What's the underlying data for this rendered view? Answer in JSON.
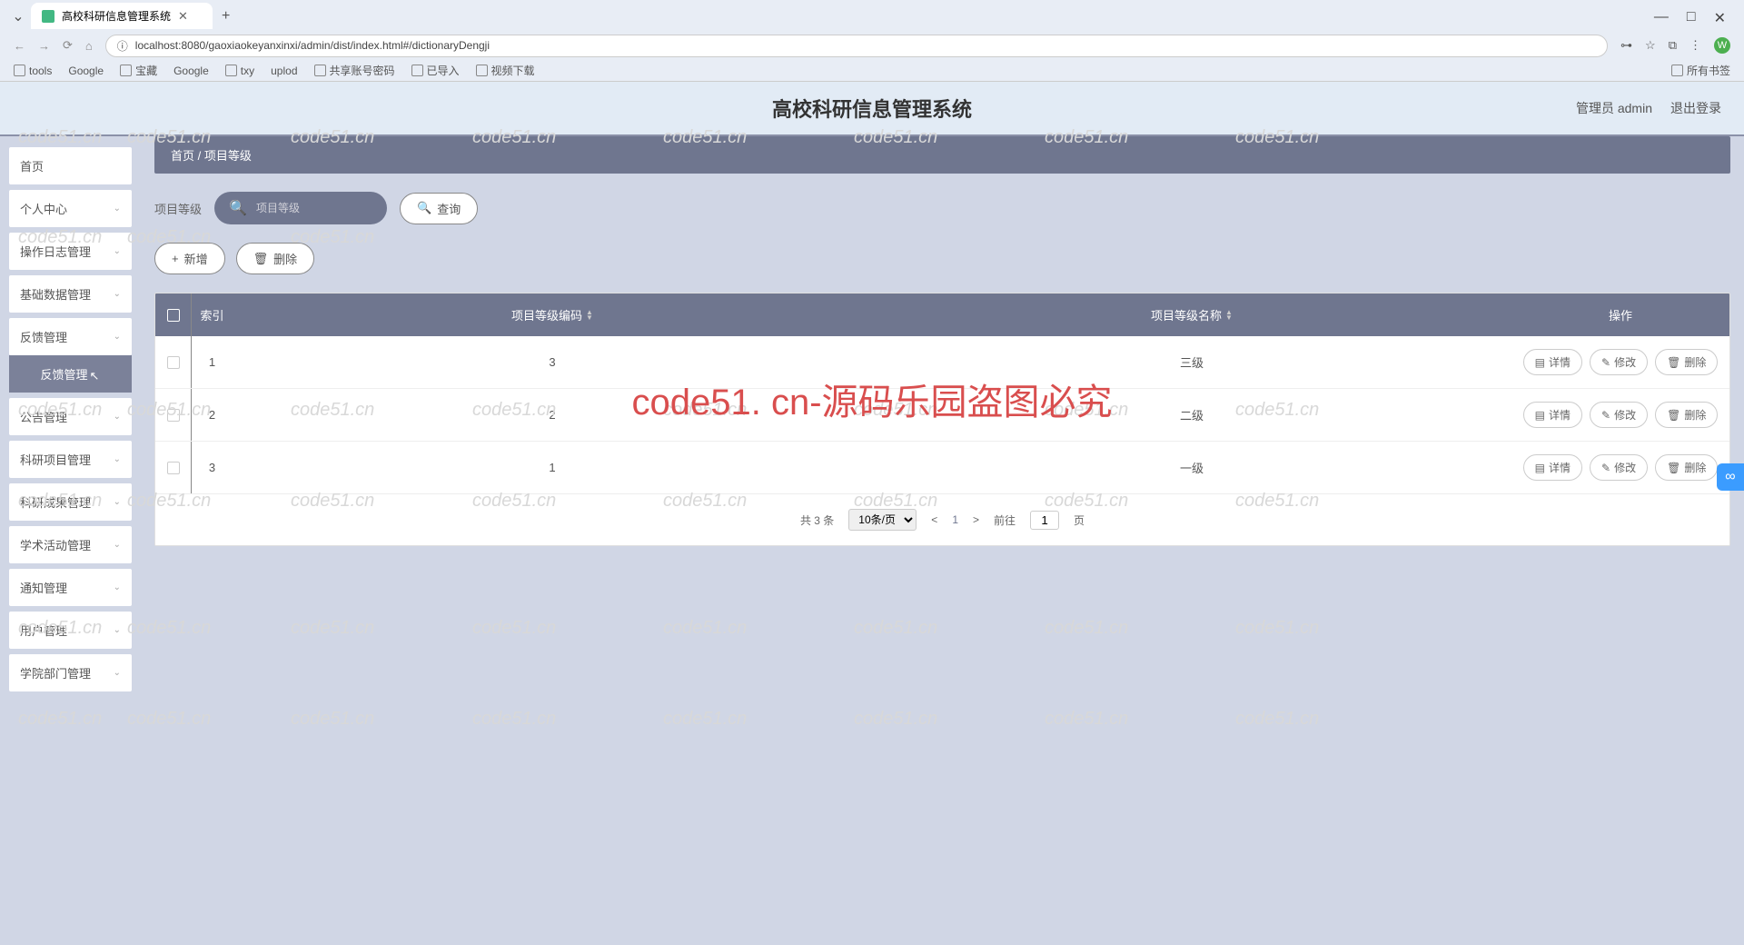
{
  "browser": {
    "tab_title": "高校科研信息管理系统",
    "url": "localhost:8080/gaoxiaokeyanxinxi/admin/dist/index.html#/dictionaryDengji",
    "bookmarks": [
      "tools",
      "Google",
      "宝藏",
      "Google",
      "txy",
      "uplod",
      "共享账号密码",
      "已导入",
      "视频下载"
    ],
    "bookmarks_right": "所有书签",
    "avatar_letter": "W"
  },
  "header": {
    "title": "高校科研信息管理系统",
    "user_label": "管理员 admin",
    "logout": "退出登录"
  },
  "sidebar": {
    "items": [
      {
        "label": "首页",
        "expandable": false
      },
      {
        "label": "个人中心",
        "expandable": true
      },
      {
        "label": "操作日志管理",
        "expandable": true
      },
      {
        "label": "基础数据管理",
        "expandable": true
      },
      {
        "label": "反馈管理",
        "expandable": true,
        "expanded": true,
        "sub": "反馈管理"
      },
      {
        "label": "公告管理",
        "expandable": true
      },
      {
        "label": "科研项目管理",
        "expandable": true
      },
      {
        "label": "科研成果管理",
        "expandable": true
      },
      {
        "label": "学术活动管理",
        "expandable": true
      },
      {
        "label": "通知管理",
        "expandable": true
      },
      {
        "label": "用户管理",
        "expandable": true
      },
      {
        "label": "学院部门管理",
        "expandable": true
      }
    ]
  },
  "breadcrumb": {
    "home": "首页",
    "sep": "/",
    "current": "项目等级"
  },
  "search": {
    "label": "项目等级",
    "placeholder": "项目等级",
    "query_btn": "查询"
  },
  "actions": {
    "add": "新增",
    "delete": "删除"
  },
  "table": {
    "headers": {
      "index": "索引",
      "code": "项目等级编码",
      "name": "项目等级名称",
      "ops": "操作"
    },
    "rows": [
      {
        "index": "1",
        "code": "3",
        "name": "三级"
      },
      {
        "index": "2",
        "code": "2",
        "name": "二级"
      },
      {
        "index": "3",
        "code": "1",
        "name": "一级"
      }
    ],
    "ops": {
      "detail": "详情",
      "edit": "修改",
      "delete": "删除"
    }
  },
  "pagination": {
    "total": "共 3 条",
    "page_size": "10条/页",
    "current": "1",
    "goto_prefix": "前往",
    "goto_suffix": "页",
    "goto_value": "1"
  },
  "watermark": "code51. cn-源码乐园盗图必究",
  "wm_small": "code51.cn"
}
